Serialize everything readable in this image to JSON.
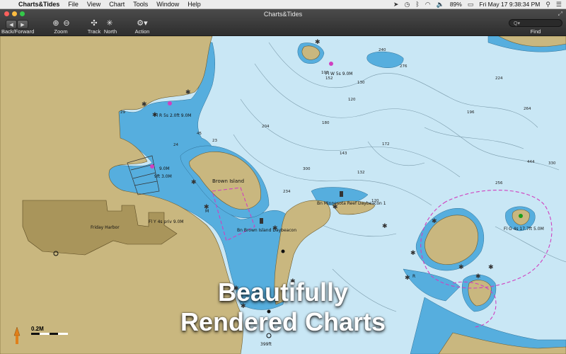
{
  "menubar": {
    "app_name": "Charts&Tides",
    "items": [
      "File",
      "View",
      "Chart",
      "Tools",
      "Window",
      "Help"
    ],
    "battery": "89%",
    "datetime": "Fri May 17  9:38:34 PM"
  },
  "window": {
    "title": "Charts&Tides"
  },
  "toolbar": {
    "back_forward_label": "Back/Forward",
    "zoom_label": "Zoom",
    "track_label": "Track",
    "north_label": "North",
    "action_label": "Action",
    "find_label": "Find",
    "search_placeholder": "Q▾"
  },
  "map": {
    "places": {
      "brown_island": "Brown Island",
      "friday_harbor": "Friday Harbor"
    },
    "lights": [
      "Fl W 5s 9.0M",
      "Fl R 5s 2.0ft 9.0M",
      "Fl Y 4s priv 9.0M",
      "Fl G 4s 17.7ft 5.0M",
      "9.0M",
      "9ft 3.0M"
    ],
    "daybeacons": [
      "Bn Brown Island Daybeacon",
      "Bn Minnesota Reef Daybeacon 1"
    ],
    "marks": {
      "R": "R",
      "M": "M",
      "bottom_depth": "399ft"
    },
    "depths": [
      "102",
      "130",
      "120",
      "152",
      "180",
      "204",
      "300",
      "240",
      "224",
      "196",
      "264",
      "330",
      "444",
      "256",
      "132",
      "172",
      "234",
      "276",
      "143",
      "120",
      "29",
      "24",
      "23",
      "45"
    ],
    "scale": "0.2M"
  },
  "overlay": {
    "line1": "Beautifully",
    "line2": "Rendered Charts"
  },
  "colors": {
    "land": "#c9b77f",
    "land_developed": "#a9955b",
    "shallow": "#56aede",
    "water": "#c9e7f5",
    "restricted": "#d040c0"
  }
}
